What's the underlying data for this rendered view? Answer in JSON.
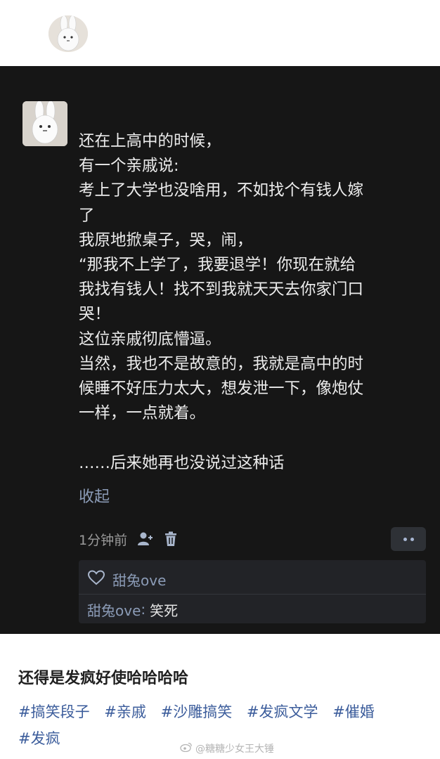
{
  "post": {
    "text": "还在上高中的时候，\n有一个亲戚说:\n考上了大学也没啥用，不如找个有钱人嫁\n了\n我原地掀桌子，哭，闹，\n“那我不上学了，我要退学！你现在就给\n我找有钱人！找不到我就天天去你家门口\n哭！\n这位亲戚彻底懵逼。\n当然，我也不是故意的，我就是高中的时\n候睡不好压力太大，想发泄一下，像炮仗\n一样，一点就着。\n\n……后来她再也没说过这种话",
    "collapse_label": "收起",
    "time": "1分钟前"
  },
  "likes": {
    "liker": "甜兔ove"
  },
  "comment": {
    "author": "甜兔ove",
    "separator": ":",
    "text": "笑死"
  },
  "caption": "还得是发疯好使哈哈哈哈",
  "tags": [
    "#搞笑段子",
    "#亲戚",
    "#沙雕搞笑",
    "#发疯文学",
    "#催婚",
    "#发疯"
  ],
  "watermark": "@糖糖少女王大锤",
  "colors": {
    "screenshot_bg": "#161616",
    "link": "#8b9bb6",
    "tag": "#3b5c9b"
  }
}
